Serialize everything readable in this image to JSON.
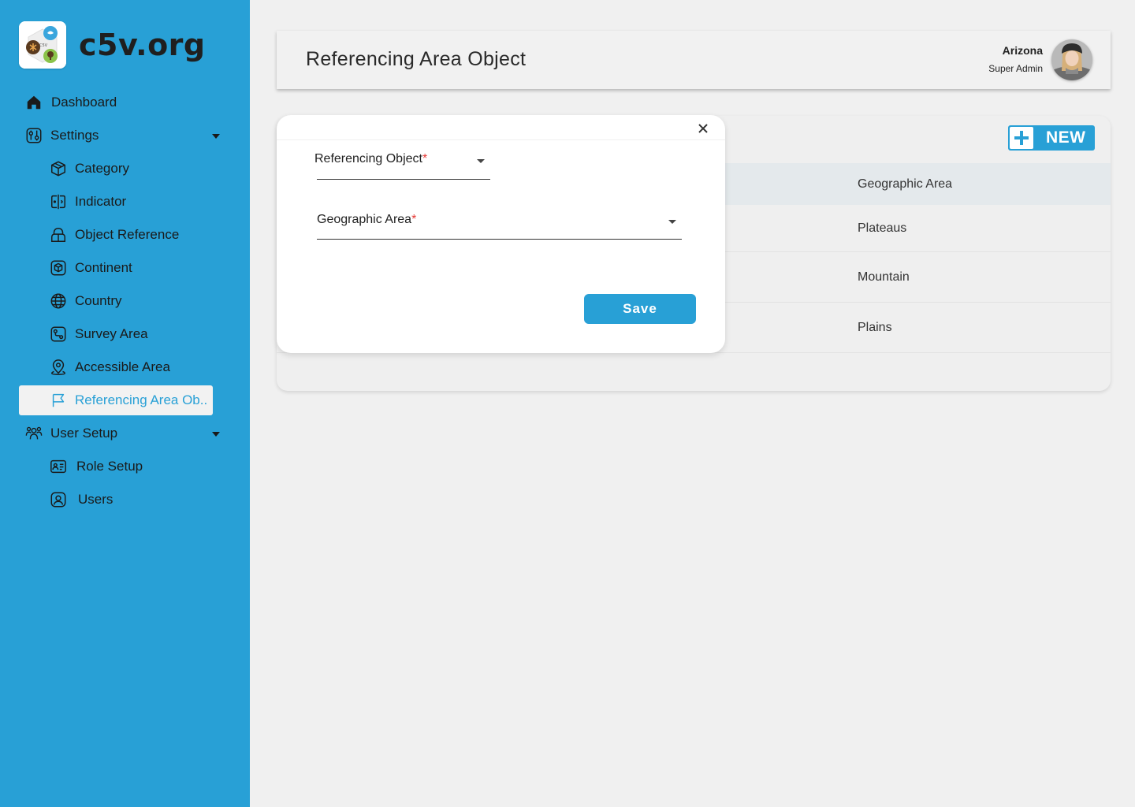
{
  "brand": {
    "name": "c5v.org"
  },
  "sidebar": {
    "items": [
      {
        "label": "Dashboard"
      },
      {
        "label": "Settings"
      },
      {
        "label": "Category"
      },
      {
        "label": "Indicator"
      },
      {
        "label": "Object Reference"
      },
      {
        "label": "Continent"
      },
      {
        "label": "Country"
      },
      {
        "label": "Survey Area"
      },
      {
        "label": "Accessible Area"
      },
      {
        "label": "Referencing Area Ob.."
      },
      {
        "label": "User Setup"
      },
      {
        "label": "Role Setup"
      },
      {
        "label": "Users"
      }
    ]
  },
  "header": {
    "title": "Referencing Area Object",
    "user_name": "Arizona",
    "user_role": "Super Admin"
  },
  "table": {
    "new_label": "NEW",
    "column_header": "Geographic Area",
    "rows": [
      "Plateaus",
      "Mountain",
      "Plains"
    ]
  },
  "modal": {
    "close_label": "×",
    "field1_label": "Referencing Object",
    "field2_label": "Geographic Area",
    "required_mark": "*",
    "save_label": "Save"
  },
  "colors": {
    "accent": "#28a0d6",
    "required": "#e53935",
    "active_bg": "#f2f2f2"
  }
}
